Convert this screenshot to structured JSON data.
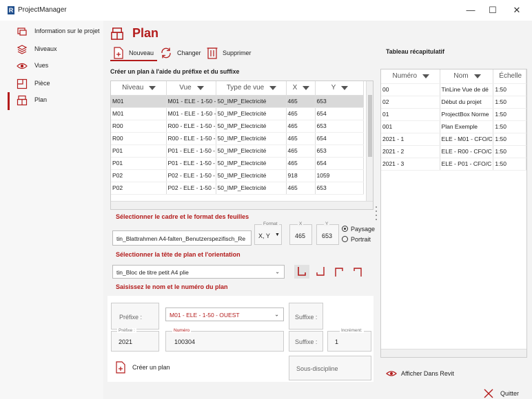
{
  "window": {
    "logo": "R",
    "title": "ProjectManager",
    "minimize": "—",
    "maximize": "☐",
    "close": "✕"
  },
  "sidebar": {
    "items": [
      {
        "label": "Information sur le projet",
        "icon": "project-info-icon"
      },
      {
        "label": "Niveaux",
        "icon": "layers-icon"
      },
      {
        "label": "Vues",
        "icon": "eye-icon"
      },
      {
        "label": "Pièce",
        "icon": "room-icon"
      },
      {
        "label": "Plan",
        "icon": "sheet-icon",
        "active": true
      }
    ]
  },
  "header": {
    "title": "Plan"
  },
  "toolbar": {
    "new_label": "Nouveau",
    "change_label": "Changer",
    "delete_label": "Supprimer"
  },
  "section1": {
    "title": "Créer un plan à l'aide du préfixe et du suffixe"
  },
  "grid": {
    "columns": [
      "Niveau",
      "Vue",
      "Type de vue",
      "X",
      "Y"
    ],
    "rows": [
      [
        "M01",
        "M01 - ELE - 1-50 - OUEST",
        "50_IMP_Electricité",
        "465",
        "653"
      ],
      [
        "M01",
        "M01 - ELE - 1-50 - EST",
        "50_IMP_Electricité",
        "465",
        "654"
      ],
      [
        "R00",
        "R00 - ELE - 1-50 - OUEST",
        "50_IMP_Electricité",
        "465",
        "653"
      ],
      [
        "R00",
        "R00 - ELE - 1-50 - EST",
        "50_IMP_Electricité",
        "465",
        "654"
      ],
      [
        "P01",
        "P01 - ELE - 1-50 - OUEST",
        "50_IMP_Electricité",
        "465",
        "653"
      ],
      [
        "P01",
        "P01 - ELE - 1-50 - EST",
        "50_IMP_Electricité",
        "465",
        "654"
      ],
      [
        "P02",
        "P02 - ELE - 1-50 - OUEST",
        "50_IMP_Electricité",
        "918",
        "1059"
      ],
      [
        "P02",
        "P02 - ELE - 1-50 - EST",
        "50_IMP_Electricité",
        "465",
        "653"
      ]
    ]
  },
  "section2": {
    "title": "Sélectionner le cadre et le format des feuilles",
    "frame_value": "tin_Blattrahmen A4-falten_Benutzerspezifisch_Re",
    "format_label": "Format",
    "format_value": "X, Y",
    "x_label": "X",
    "x_value": "465",
    "y_label": "Y",
    "y_value": "653",
    "orientation_landscape": "Paysage",
    "orientation_portrait": "Portrait"
  },
  "section3": {
    "title": "Sélectionner la tête de plan et l'orientation",
    "titleblock_value": "tin_Bloc de titre petit A4 plie"
  },
  "section4": {
    "title": "Saisissez le nom et le numéro du plan",
    "prefix_button": "Préfixe :",
    "view_value": "M01 - ELE - 1-50 - OUEST",
    "suffix_button": "Suffixe :",
    "prefix_label": "Préfixe :",
    "prefix_value": "2021",
    "number_label": "Numéro",
    "number_value": "100304",
    "suffix_button2": "Suffixe :",
    "increment_label": "Incrément:",
    "increment_value": "1",
    "create_label": "Créer un plan",
    "subdiscipline_label": "Sous-discipline"
  },
  "summary": {
    "title": "Tableau récapitulatif",
    "columns": [
      "Numéro",
      "Nom",
      "Échelle"
    ],
    "rows": [
      [
        "00",
        "TinLine Vue de dé",
        "1:50"
      ],
      [
        "02",
        "Début du projet",
        "1:50"
      ],
      [
        "01",
        "ProjectBox Norme",
        "1:50"
      ],
      [
        "001",
        "Plan Exemple",
        "1:50"
      ],
      [
        "2021 - 1",
        "ELE - M01 - CFO/C",
        "1:50"
      ],
      [
        "2021 - 2",
        "ELE - R00 - CFO/C",
        "1:50"
      ],
      [
        "2021 - 3",
        "ELE - P01 - CFO/C",
        "1:50"
      ]
    ],
    "show_in_revit": "Afficher Dans Revit"
  },
  "footer": {
    "quit_label": "Quitter"
  },
  "colors": {
    "accent": "#b31b1b",
    "brand": "#1f4e8c"
  }
}
